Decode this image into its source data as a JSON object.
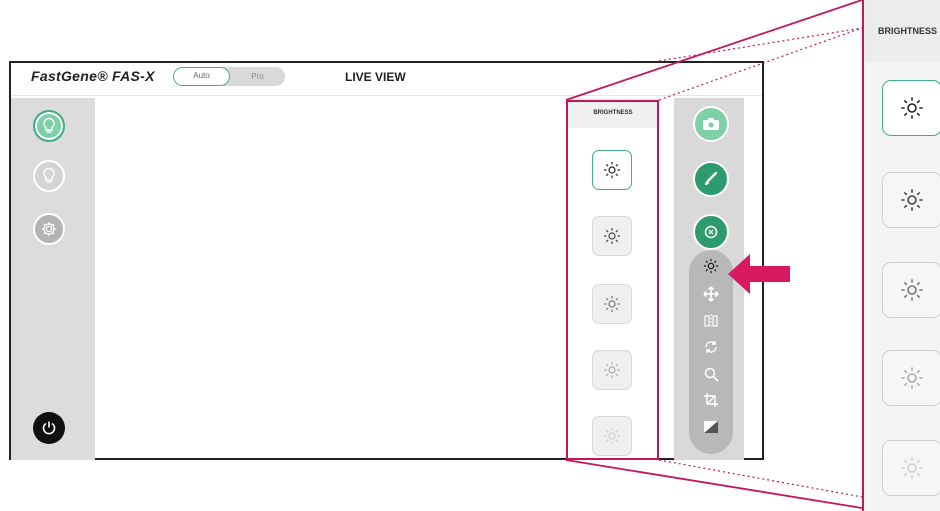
{
  "app": {
    "logo": "FastGene® FAS-X",
    "title": "LIVE VIEW"
  },
  "mode": {
    "auto_label": "Auto",
    "pro_label": "Pro",
    "selected": "Auto"
  },
  "left_bar": {
    "items": [
      "light-on-icon",
      "light-off-icon",
      "gear-icon",
      "power-icon"
    ]
  },
  "brightness": {
    "heading": "BRIGHTNESS",
    "levels": 5,
    "selected_index": 0
  },
  "tools": {
    "buttons": [
      "camera-icon",
      "brush-icon",
      "reset-icon"
    ],
    "strip": [
      "sun-icon",
      "move-icon",
      "mirror-icon",
      "rotate-icon",
      "zoom-icon",
      "crop-icon",
      "contrast-icon"
    ]
  },
  "colors": {
    "accent": "#3fae8a",
    "highlight": "#c2185b"
  }
}
